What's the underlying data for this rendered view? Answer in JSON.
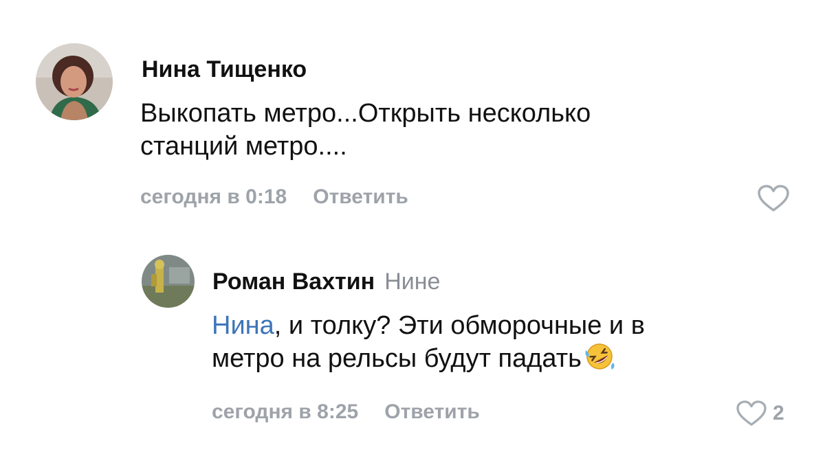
{
  "comments": [
    {
      "author": "Нина Тищенко",
      "text_line1": "Выкопать метро...Открыть несколько",
      "text_line2": "станций метро....",
      "time": "сегодня в 0:18",
      "reply_label": "Ответить"
    },
    {
      "author": "Роман Вахтин",
      "reply_to": "Нине",
      "mention": "Нина",
      "text_line1_rest": ", и толку? Эти обморочные и в",
      "text_line2": "метро на рельсы будут падать",
      "emoji": "rolling-on-floor-laughing-emoji",
      "time": "сегодня в 8:25",
      "reply_label": "Ответить",
      "likes": "2"
    }
  ],
  "colors": {
    "text": "#111111",
    "meta": "#9ea3aa",
    "mention": "#3d75b8",
    "icon": "#a7adb4"
  }
}
